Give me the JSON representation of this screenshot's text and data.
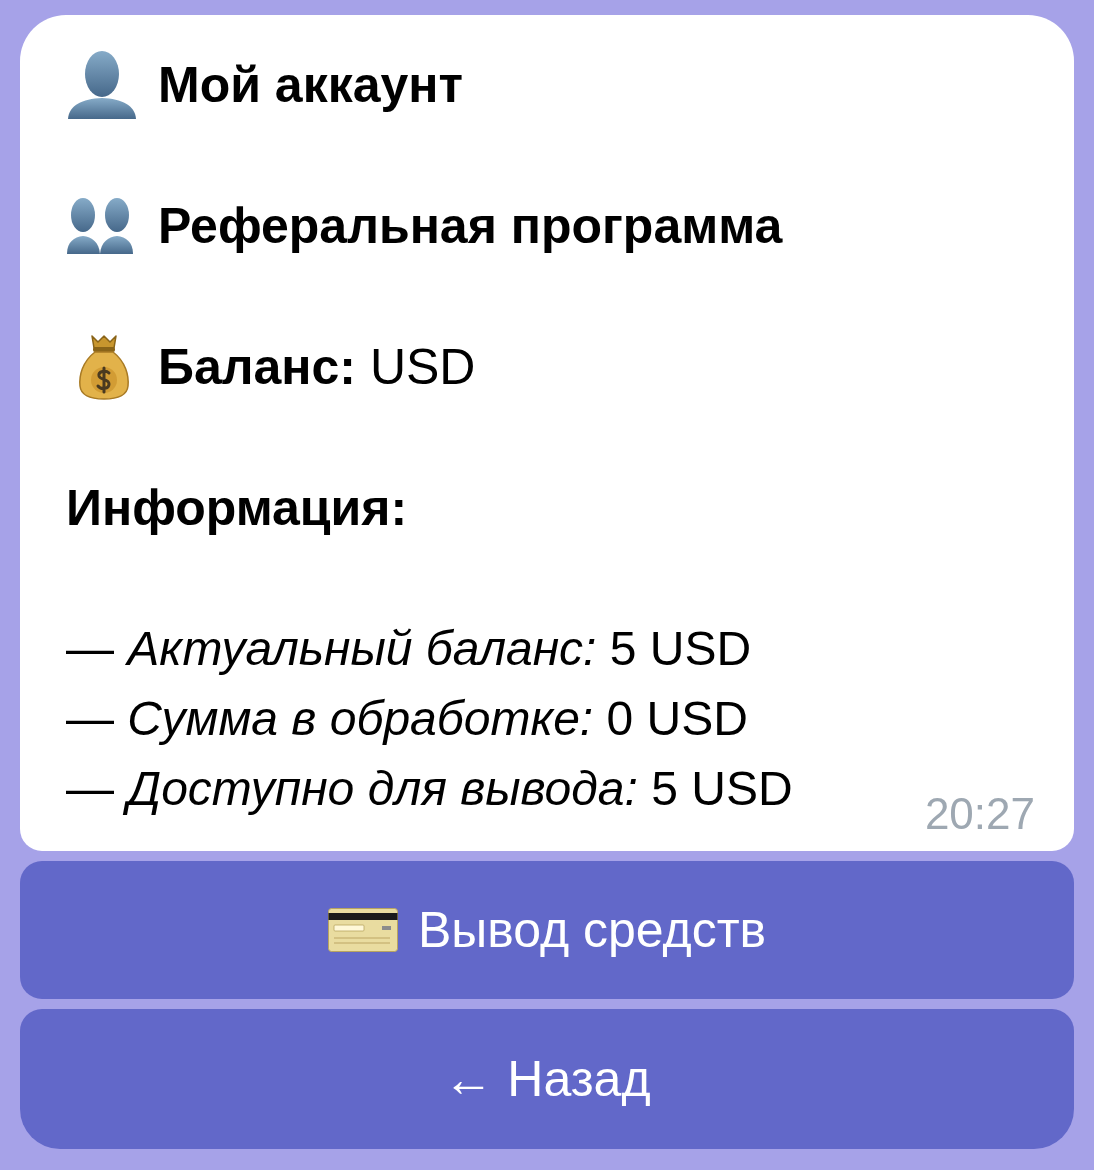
{
  "message": {
    "account": "Мой аккаунт",
    "referral": "Реферальная программа",
    "balance": "**Баланс:** USD",
    "info_title": "Информация:",
    "info_lines": [
      "— *Актуальный баланс:* 5 USD",
      "— *Сумма в обработке:* 0 USD",
      "— *Доступно для вывода:* 5 USD"
    ],
    "time": "20:27"
  },
  "keyboard": [
    {
      "kind": "withdraw",
      "label": "Вывод средств"
    },
    {
      "kind": "back",
      "label": "← Назад"
    }
  ]
}
